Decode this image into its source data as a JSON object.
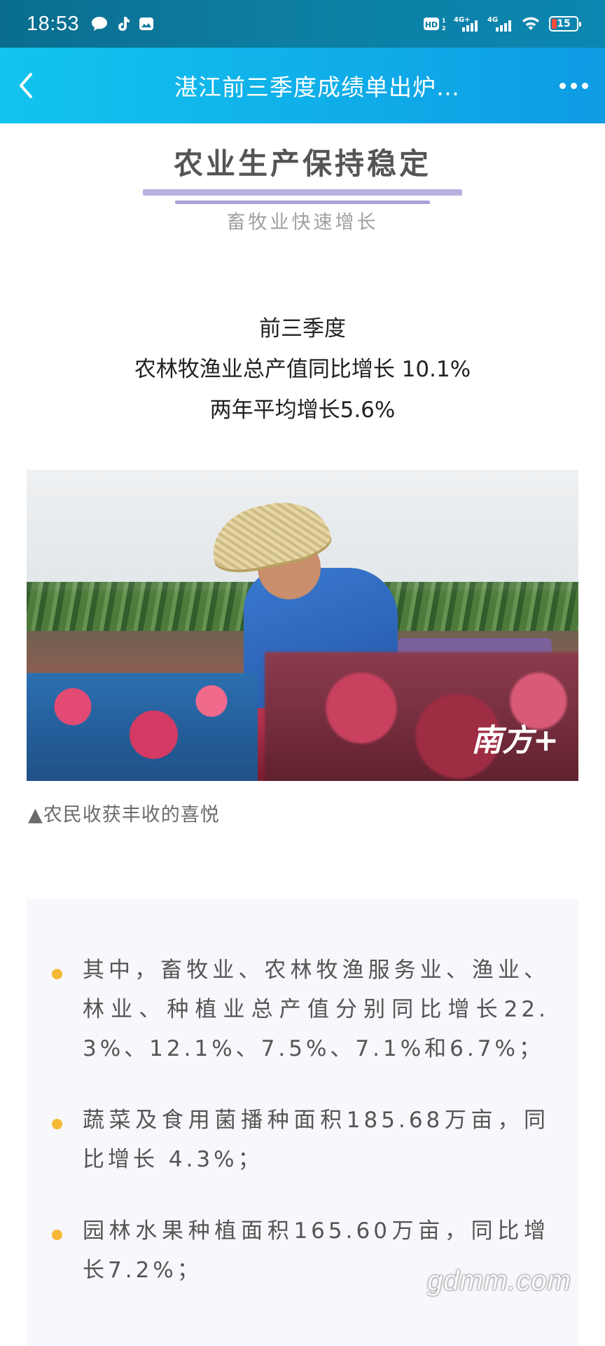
{
  "status_bar": {
    "time": "18:53",
    "left_icons": [
      "chat-bubble-icon",
      "tiktok-icon",
      "gallery-icon"
    ],
    "hd_label": "HD",
    "network1": "4G+",
    "network2": "4G",
    "battery_level": "15",
    "battery_color": "#ff4a3d"
  },
  "nav": {
    "title": "湛江前三季度成绩单出炉…",
    "back_icon": "chevron-left-icon",
    "more_icon": "more-dots-icon",
    "gradient_start": "#12c4ee",
    "gradient_end": "#0e9be3"
  },
  "article": {
    "headline": "农业生产保持稳定",
    "subheadline": "畜牧业快速增长",
    "stats": {
      "line1": "前三季度",
      "line2": "农林牧渔业总产值同比增长 10.1%",
      "line3": "两年平均增长5.6%"
    },
    "photo_logo": "南方+",
    "caption": "▲农民收获丰收的喜悦",
    "bullets": [
      "其中，畜牧业、农林牧渔服务业、渔业、林业、种植业总产值分别同比增长22.3%、12.1%、7.5%、7.1%和6.7%；",
      "蔬菜及食用菌播种面积185.68万亩，同比增长 4.3%；",
      "园林水果种植面积165.60万亩，同比增长7.2%；"
    ],
    "bullet_color": "#f5b936",
    "accent_bar_color": "#b7b1e0"
  },
  "watermark": "gdmm.com"
}
